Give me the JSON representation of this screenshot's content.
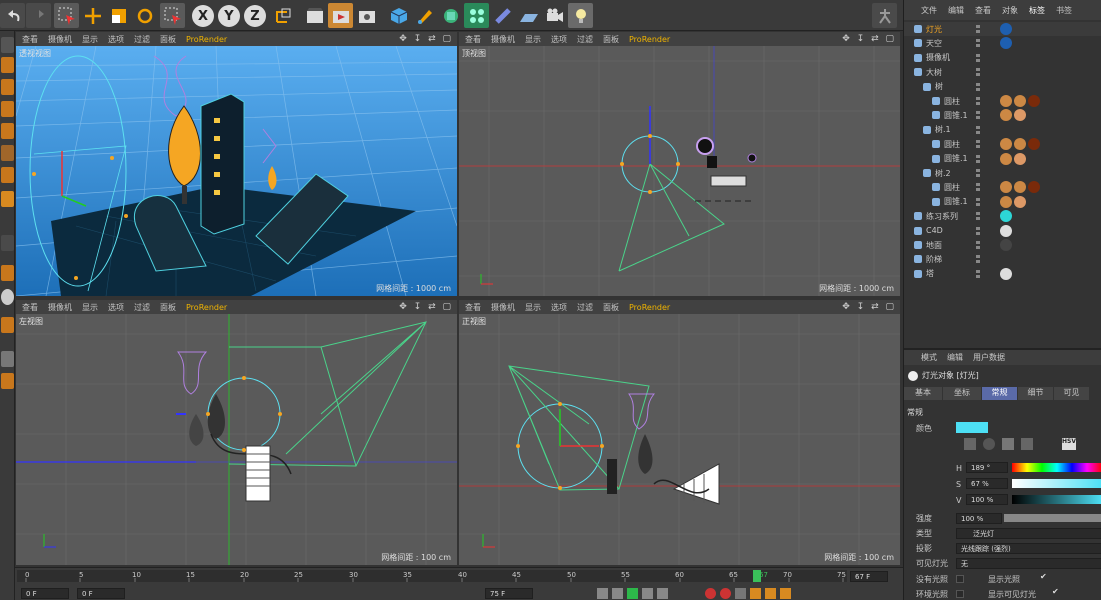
{
  "viewport_menu": [
    "查看",
    "摄像机",
    "显示",
    "选项",
    "过滤",
    "面板",
    "ProRender"
  ],
  "viewports": {
    "perspective": {
      "title": "透视视图",
      "grid": "网格间距 : 1000 cm"
    },
    "top": {
      "title": "顶视图",
      "grid": "网格间距 : 1000 cm"
    },
    "left": {
      "title": "左视图",
      "grid": "网格间距 : 100 cm"
    },
    "front": {
      "title": "正视图",
      "grid": "网格间距 : 100 cm"
    }
  },
  "viewport_icons": "✥ ↧ ⇄ ▢",
  "toolbar": {
    "x_label": "X",
    "y_label": "Y",
    "z_label": "Z"
  },
  "object_manager": {
    "menu": [
      "文件",
      "编辑",
      "查看",
      "对象",
      "标签",
      "书签"
    ],
    "objects": [
      {
        "name": "灯光",
        "indent": 0,
        "icon": "light-icon",
        "color": "#f4a623"
      },
      {
        "name": "天空",
        "indent": 0,
        "icon": "sky-icon",
        "color": "#c8c8c8"
      },
      {
        "name": "摄像机",
        "indent": 0,
        "icon": "camera-icon",
        "color": "#c8c8c8"
      },
      {
        "name": "大树",
        "indent": 0,
        "icon": "null-icon",
        "color": "#c8c8c8"
      },
      {
        "name": "树",
        "indent": 1,
        "icon": "null-icon",
        "color": "#c8c8c8"
      },
      {
        "name": "圆柱",
        "indent": 2,
        "icon": "cylinder-icon",
        "color": "#c8c8c8"
      },
      {
        "name": "圆锥.1",
        "indent": 2,
        "icon": "cone-icon",
        "color": "#c8c8c8"
      },
      {
        "name": "树.1",
        "indent": 1,
        "icon": "null-icon",
        "color": "#c8c8c8"
      },
      {
        "name": "圆柱",
        "indent": 2,
        "icon": "cylinder-icon",
        "color": "#c8c8c8"
      },
      {
        "name": "圆锥.1",
        "indent": 2,
        "icon": "cone-icon",
        "color": "#c8c8c8"
      },
      {
        "name": "树.2",
        "indent": 1,
        "icon": "null-icon",
        "color": "#c8c8c8"
      },
      {
        "name": "圆柱",
        "indent": 2,
        "icon": "cylinder-icon",
        "color": "#c8c8c8"
      },
      {
        "name": "圆锥.1",
        "indent": 2,
        "icon": "cone-icon",
        "color": "#c8c8c8"
      },
      {
        "name": "练习系列",
        "indent": 0,
        "icon": "null-icon",
        "color": "#c8c8c8"
      },
      {
        "name": "C4D",
        "indent": 0,
        "icon": "null-icon",
        "color": "#c8c8c8"
      },
      {
        "name": "地面",
        "indent": 0,
        "icon": "floor-icon",
        "color": "#c8c8c8"
      },
      {
        "name": "阶梯",
        "indent": 0,
        "icon": "stairs-icon",
        "color": "#c8c8c8"
      },
      {
        "name": "塔",
        "indent": 0,
        "icon": "null-icon",
        "color": "#c8c8c8"
      }
    ]
  },
  "attributes": {
    "menu": [
      "模式",
      "编辑",
      "用户数据"
    ],
    "object_title": "灯光对象 [灯光]",
    "tabs": [
      "基本",
      "坐标",
      "常规",
      "细节",
      "可见"
    ],
    "active_tab": "常规",
    "section": "常规",
    "color_label": "颜色",
    "color_hex": "#4de0f5",
    "h_label": "H",
    "h_value": "189 °",
    "s_label": "S",
    "s_value": "67 %",
    "v_label": "V",
    "v_value": "100 %",
    "intensity_label": "强度",
    "intensity_value": "100 %",
    "type_label": "类型",
    "type_value": "泛光灯",
    "shadow_label": "投影",
    "shadow_value": "光线跟踪 (强烈)",
    "visible_light_label": "可见灯光",
    "visible_light_value": "无",
    "no_illum_label": "没有光照",
    "show_illum_label": "显示光照",
    "ambient_label": "环境光照",
    "show_visible_label": "显示可见灯光",
    "hsv_label": "HSV"
  },
  "timeline": {
    "ticks": [
      "0",
      "5",
      "10",
      "15",
      "20",
      "25",
      "30",
      "35",
      "40",
      "45",
      "50",
      "55",
      "60",
      "65",
      "70",
      "75"
    ],
    "current": "67",
    "end_field": "67 F",
    "start_field": "0 F",
    "fps_field": "0 F",
    "max_field": "75 F"
  }
}
